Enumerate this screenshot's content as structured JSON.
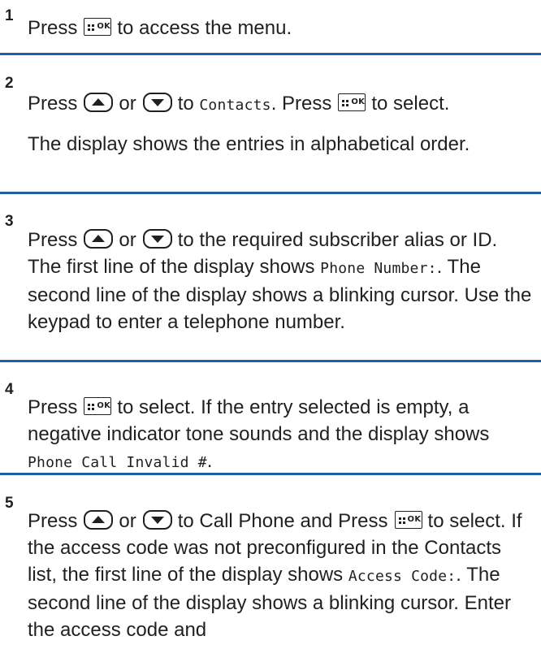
{
  "steps": [
    {
      "number": "1",
      "t1": "Press",
      "t2": "to access the menu."
    },
    {
      "number": "2",
      "t1": "Press",
      "t2": "or",
      "t3": "to",
      "m1": "Contacts",
      "t4": ". Press",
      "t5": "to select.",
      "note": "The display shows the entries in alphabetical order."
    },
    {
      "number": "3",
      "t1": "Press",
      "t2": "or",
      "t3": "to the required subscriber alias or ID. The first line of the display shows",
      "m1": "Phone Number:",
      "t4": ". The second line of the display shows a blinking cursor. Use the keypad to enter a telephone number."
    },
    {
      "number": "4",
      "t1": "Press",
      "t2": "to select. If the entry selected is empty, a negative indicator tone sounds and the display shows",
      "m1": "Phone Call Invalid #",
      "t3": "."
    },
    {
      "number": "5",
      "t1": "Press",
      "t2": "or",
      "t3": "to Call Phone and Press",
      "t4": "to select. If the access code was not preconfigured in the Contacts list, the first line of the display shows",
      "m1": "Access Code:",
      "t5": ". The second line of the display shows a blinking cursor. Enter the access code and"
    }
  ],
  "key_labels": {
    "ok": "OK"
  },
  "icons": {
    "menu_ok_key": "menu-ok-key-icon",
    "up_key": "up-arrow-key-icon",
    "down_key": "down-arrow-key-icon"
  },
  "colors": {
    "rule": "#1f5fa8",
    "text": "#231f20"
  }
}
